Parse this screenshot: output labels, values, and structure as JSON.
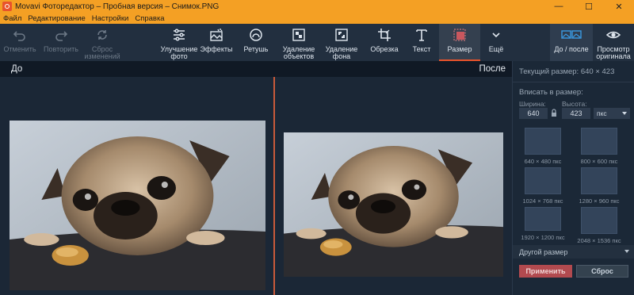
{
  "window": {
    "title": "Movavi Фоторедактор – Пробная версия – Снимок.PNG",
    "min": "—",
    "max": "☐",
    "close": "✕"
  },
  "menu": [
    "Файл",
    "Редактирование",
    "Настройки",
    "Справка"
  ],
  "toolbar": {
    "undo": "Отменить",
    "redo": "Повторить",
    "reset_changes": "Сброс\nизменений",
    "enhance": "Улучшение\nфото",
    "effects": "Эффекты",
    "retouch": "Ретушь",
    "remove_objects": "Удаление\nобъектов",
    "remove_bg": "Удаление\nфона",
    "crop": "Обрезка",
    "text": "Текст",
    "resize": "Размер",
    "more": "Ещё",
    "before_after": "До / после",
    "original_view": "Просмотр\nоригинала"
  },
  "compare": {
    "before": "До",
    "after": "После"
  },
  "panel": {
    "current_size": "Текущий размер: 640 × 423",
    "fit_label": "Вписать в размер:",
    "width_label": "Ширина:",
    "height_label": "Высота:",
    "width": "640",
    "height": "423",
    "unit": "пкс",
    "presets": [
      "640 × 480 пкс",
      "800 × 600 пкс",
      "1024 × 768 пкс",
      "1280 × 960 пкс",
      "1920 × 1200 пкс",
      "2048 × 1536 пкс"
    ],
    "other_size": "Другой размер",
    "apply": "Применить",
    "reset": "Сброс"
  },
  "colors": {
    "accent": "#f4a024",
    "apply": "#b24a4f",
    "divider": "#c95a3a"
  }
}
